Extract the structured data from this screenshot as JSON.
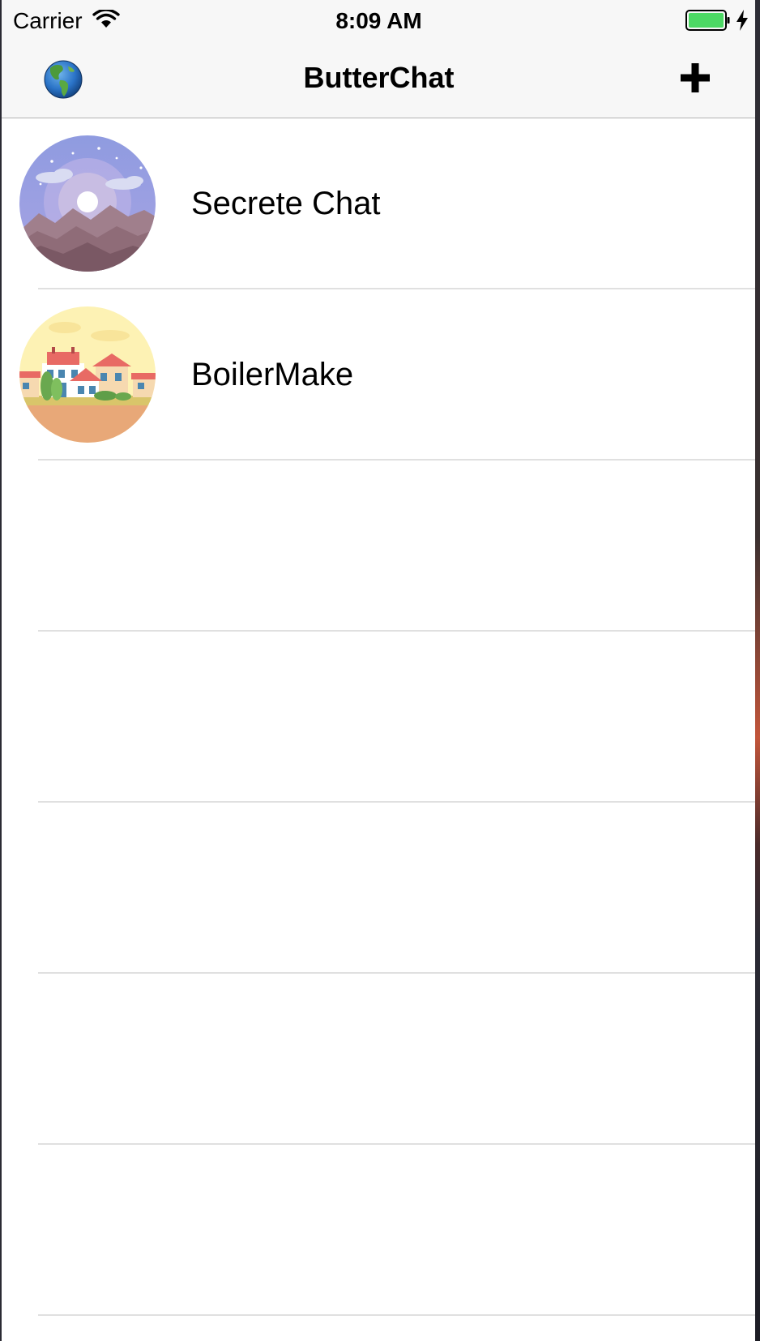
{
  "status_bar": {
    "carrier": "Carrier",
    "time": "8:09 AM",
    "battery_color": "#4cd964"
  },
  "nav": {
    "title": "ButterChat",
    "left_icon": "globe-icon",
    "right_icon": "plus-icon"
  },
  "chats": [
    {
      "name": "Secrete Chat",
      "avatar": "moonlit-mountains-avatar"
    },
    {
      "name": "BoilerMake",
      "avatar": "town-houses-avatar"
    },
    {
      "name": ""
    },
    {
      "name": ""
    },
    {
      "name": ""
    },
    {
      "name": ""
    },
    {
      "name": ""
    }
  ]
}
